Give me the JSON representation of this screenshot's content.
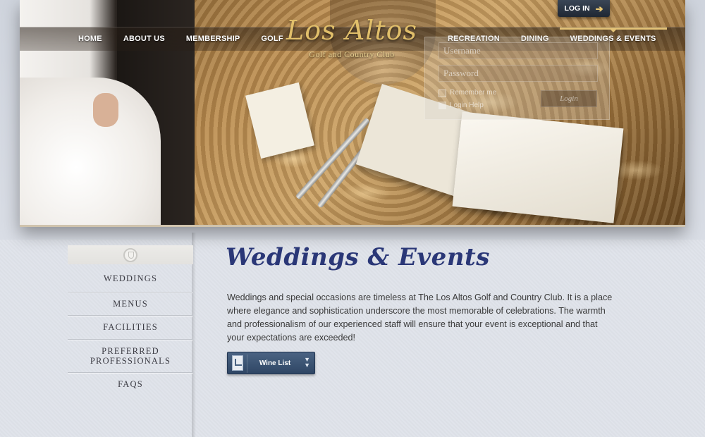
{
  "nav": {
    "left": [
      "HOME",
      "ABOUT US",
      "MEMBERSHIP",
      "GOLF"
    ],
    "right": [
      "RECREATION",
      "DINING",
      "WEDDINGS & EVENTS"
    ]
  },
  "logo": {
    "script": "Los Altos",
    "subtitle": "Golf and Country Club"
  },
  "login": {
    "tab_label": "LOG IN",
    "username_placeholder": "Username",
    "password_placeholder": "Password",
    "remember_label": "Remember me",
    "help_label": "Login Help",
    "submit_label": "Login"
  },
  "sidebar": {
    "items": [
      "WEDDINGS",
      "MENUS",
      "FACILITIES",
      "PREFERRED PROFESSIONALS",
      "FAQS"
    ]
  },
  "main": {
    "title": "Weddings & Events",
    "body": "Weddings and special occasions are timeless at The Los Altos Golf and Country Club. It is a place where elegance and sophistication underscore the most memorable of celebrations. The warmth and professionalism of our experienced staff will ensure that your event is exceptional and that your expectations are exceeded!",
    "button_label": "Wine List"
  },
  "colors": {
    "accent_gold": "#e3c277",
    "title_blue": "#2a3777",
    "button_blue": "#3b5273"
  }
}
